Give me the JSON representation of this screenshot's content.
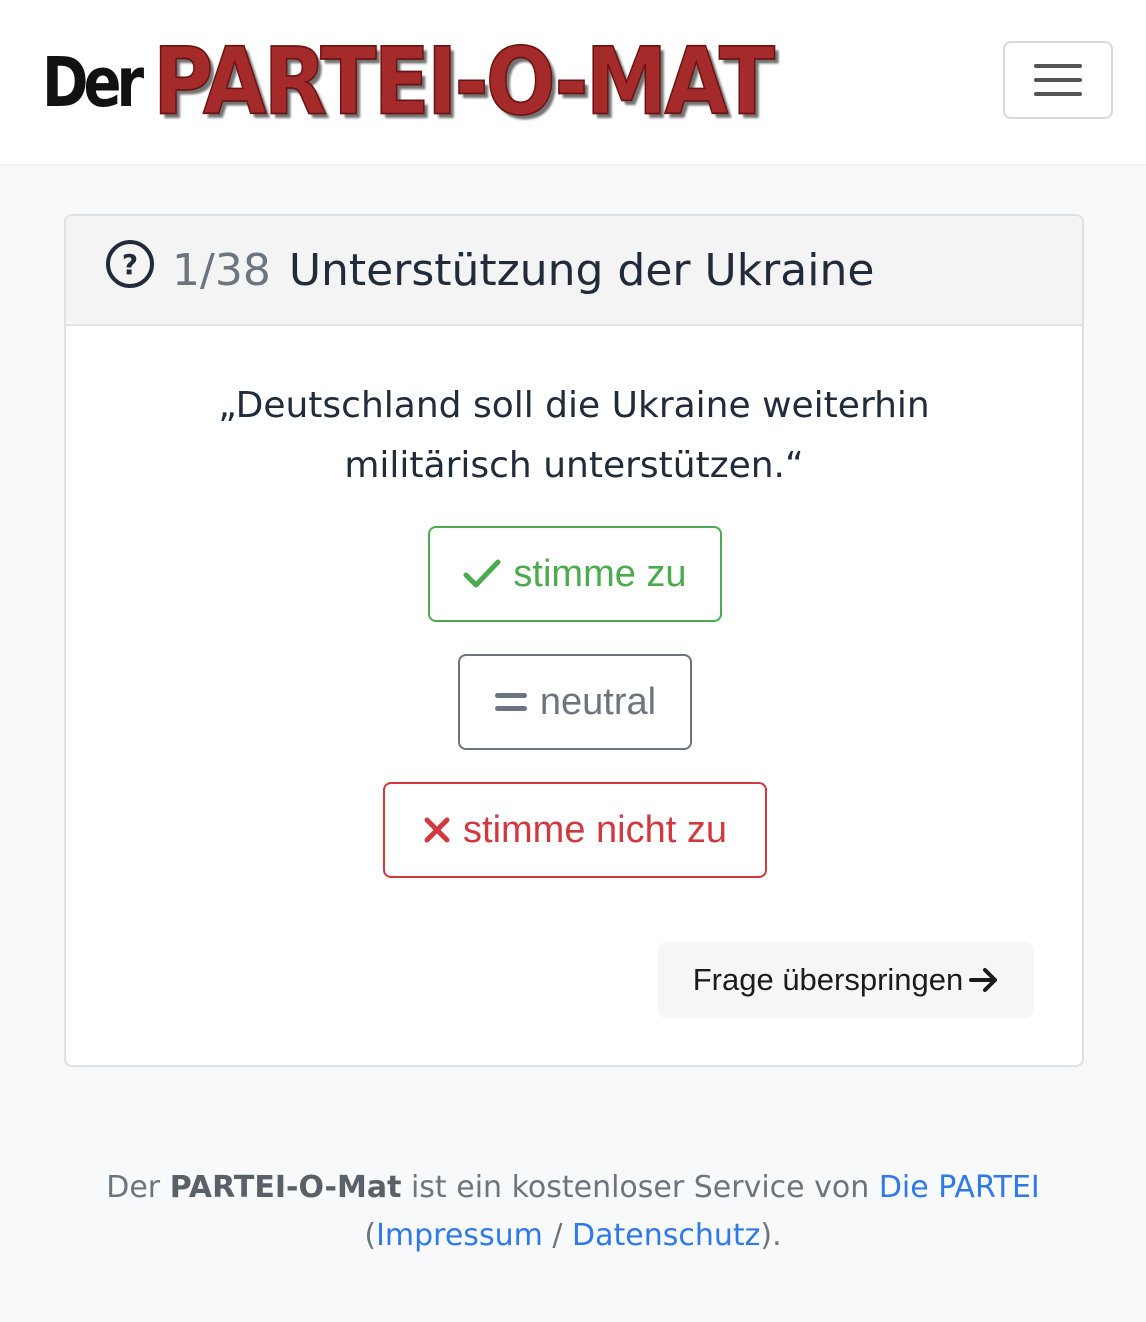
{
  "header": {
    "brand_prefix": "Der",
    "brand_main": "PARTEI-O-MAT",
    "menu_icon": "hamburger-menu-icon"
  },
  "question": {
    "counter": "1/38",
    "title": "Unterstützung der Ukraine",
    "help_icon": "question-circle-icon",
    "statement": "„Deutschland soll die Ukraine weiterhin militärisch unterstützen.“"
  },
  "answers": {
    "agree_label": "stimme zu",
    "agree_icon": "check-icon",
    "neutral_label": "neutral",
    "neutral_icon": "equals-icon",
    "disagree_label": "stimme nicht zu",
    "disagree_icon": "x-icon",
    "skip_label": "Frage überspringen",
    "skip_icon": "arrow-right-icon"
  },
  "footer": {
    "text_der": "Der",
    "brand": "PARTEI-O-Mat",
    "text_service": "ist ein kostenloser Service von",
    "party_link": "Die PARTEI",
    "open_paren": "(",
    "impressum_link": "Impressum",
    "separator": "/",
    "datenschutz_link": "Datenschutz",
    "close_paren": ")."
  },
  "colors": {
    "agree": "#4caa4f",
    "neutral": "#6c757d",
    "disagree": "#d0393f",
    "brand_red": "#a52a2a",
    "link": "#2f79e8"
  }
}
